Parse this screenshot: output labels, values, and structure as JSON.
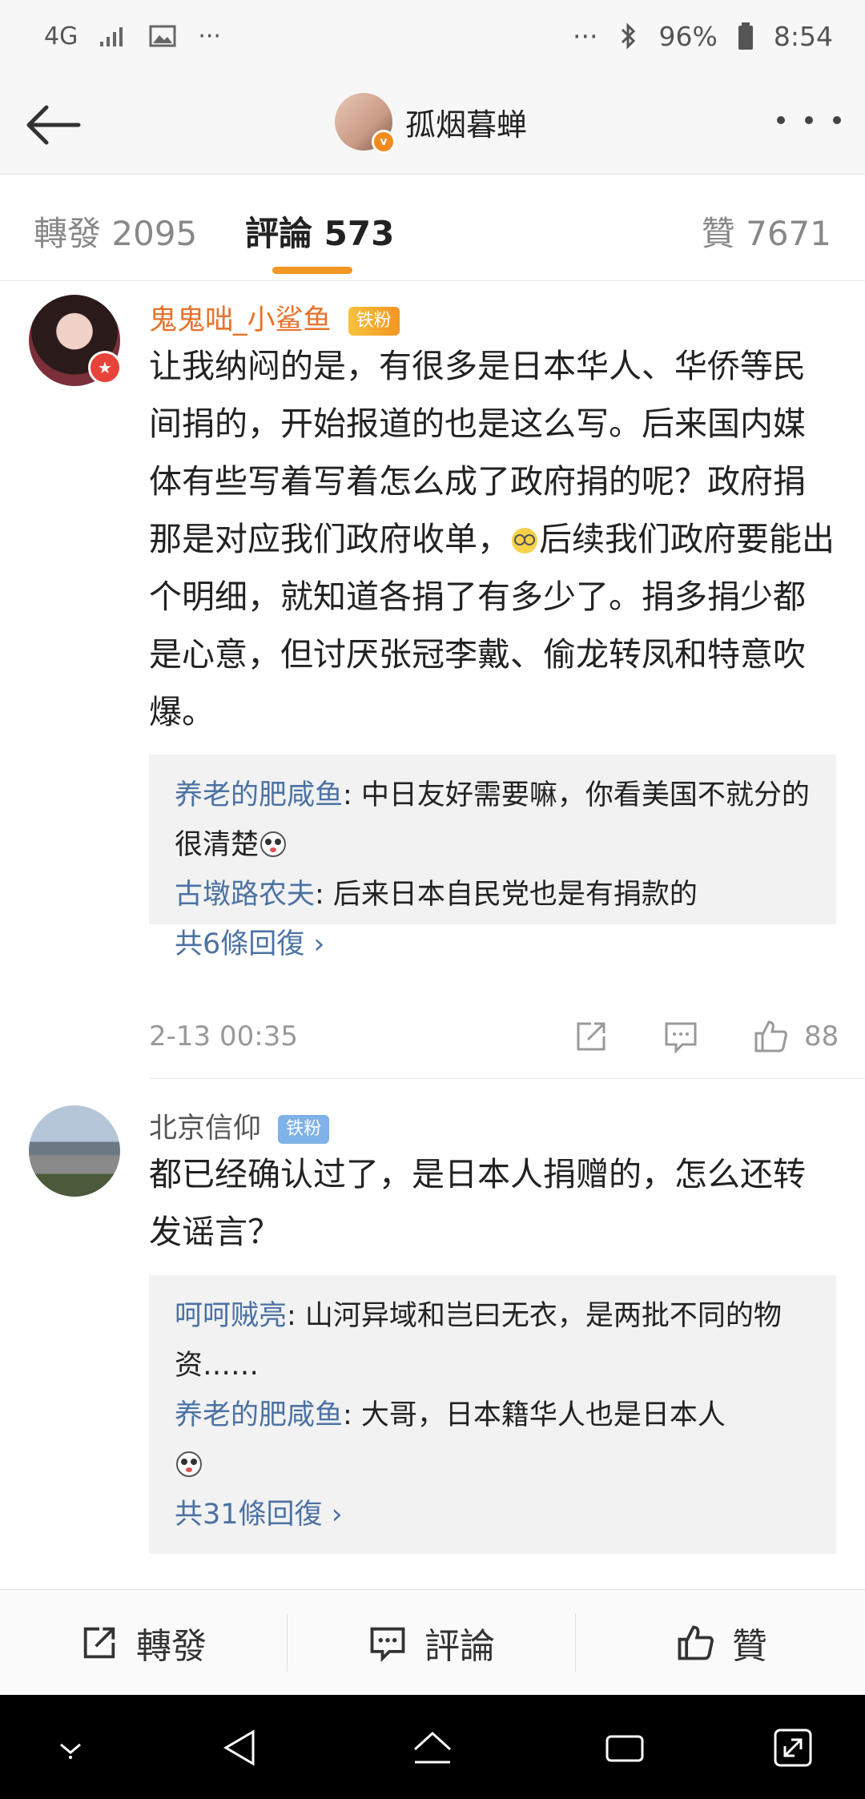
{
  "status_bar": {
    "network": "4G",
    "extras": "···",
    "battery": "96%",
    "time": "8:54"
  },
  "header": {
    "title": "孤烟暮蝉",
    "badge": "v"
  },
  "tabs": [
    {
      "label": "轉發 2095",
      "active": false
    },
    {
      "label": "評論 573",
      "active": true
    },
    {
      "label": "贊 7671",
      "active": false
    }
  ],
  "comments": [
    {
      "user": "鬼鬼咄_小鲨鱼",
      "fan_badge": "铁粉",
      "text": "让我纳闷的是，有很多是日本华人、华侨等民间捐的，开始报道的也是这么写。后来国内媒体有些写着写着怎么成了政府捐的呢？政府捐那是对应我们政府收单，",
      "text_after_emoji": "后续我们政府要能出个明细，就知道各捐了有多少了。捐多捐少都是心意，但讨厌张冠李戴、偷龙转凤和特意吹爆。",
      "replies": [
        {
          "user": "养老的肥咸鱼",
          "text": ": 中日友好需要嘛，你看美国不就分的很清楚"
        },
        {
          "user": "古墩路农夫",
          "text": ": 后来日本自民党也是有捐款的"
        }
      ],
      "more_replies": "共6條回復 ›",
      "date": "2-13 00:35",
      "likes": "88"
    },
    {
      "user": "北京信仰",
      "fan_badge": "铁粉",
      "text": "都已经确认过了，是日本人捐赠的，怎么还转发谣言？",
      "replies": [
        {
          "user": "呵呵贼亮",
          "text": ": 山河异域和岂曰无衣，是两批不同的物资……"
        },
        {
          "user": "养老的肥咸鱼",
          "text": ": 大哥，日本籍华人也是日本人"
        }
      ],
      "more_replies": "共31條回復 ›"
    }
  ],
  "bottom_bar": {
    "repost": "轉發",
    "comment": "評論",
    "like": "贊"
  },
  "icons": [
    "back-arrow-icon",
    "more-icon",
    "share-icon",
    "comment-icon",
    "like-icon",
    "nav-down-icon",
    "nav-back-icon",
    "nav-home-icon",
    "nav-recents-icon",
    "nav-expand-icon"
  ],
  "colors": {
    "accent": "#f29624",
    "link": "#4b72a4",
    "username_orange": "#e8722a"
  }
}
